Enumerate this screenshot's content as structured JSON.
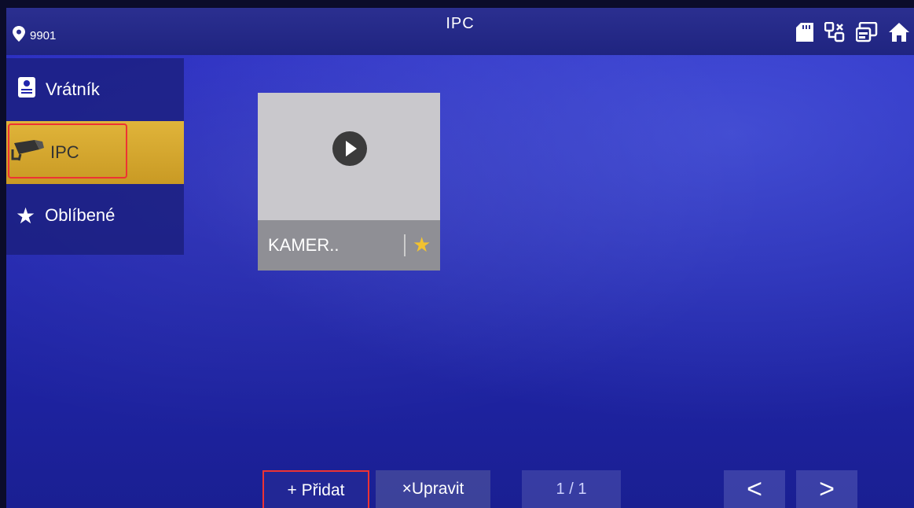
{
  "statusbar": {
    "device_id": "9901",
    "title": "IPC"
  },
  "sidebar": {
    "items": [
      {
        "label": "Vrátník",
        "icon": "intercom-icon"
      },
      {
        "label": "IPC",
        "icon": "camera-icon"
      },
      {
        "label": "Oblíbené",
        "icon": "star-icon"
      }
    ],
    "active_index": 1
  },
  "camera_tile": {
    "name": "KAMER..",
    "favorite": true
  },
  "bottom_bar": {
    "add_label": "+ Přidat",
    "edit_label": "×Upravit",
    "page_indicator": "1 / 1",
    "prev_label": "<",
    "next_label": ">"
  },
  "colors": {
    "accent": "#e0b43a",
    "background": "#2126ad",
    "highlight_outline": "#e33333"
  }
}
